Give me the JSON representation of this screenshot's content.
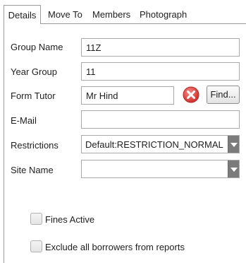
{
  "tabs": [
    {
      "label": "Details"
    },
    {
      "label": "Move To"
    },
    {
      "label": "Members"
    },
    {
      "label": "Photograph"
    }
  ],
  "form": {
    "group_name": {
      "label": "Group Name",
      "value": "11Z"
    },
    "year_group": {
      "label": "Year Group",
      "value": "11"
    },
    "form_tutor": {
      "label": "Form Tutor",
      "value": "Mr Hind",
      "find_label": "Find..."
    },
    "email": {
      "label": "E-Mail",
      "value": ""
    },
    "restrictions": {
      "label": "Restrictions",
      "selected": "Default:RESTRICTION_NORMAL"
    },
    "site_name": {
      "label": "Site Name",
      "selected": ""
    }
  },
  "options": {
    "fines_active": {
      "label": "Fines Active",
      "checked": false
    },
    "exclude_reports": {
      "label": "Exclude all borrowers from reports",
      "checked": false
    }
  },
  "icons": {
    "clear": "clear-icon",
    "dropdown": "chevron-down-icon"
  },
  "colors": {
    "clear_icon": "#e0423f",
    "border": "#a9a9a9",
    "dropdown_arrow_bg": "#7b7b7b"
  }
}
